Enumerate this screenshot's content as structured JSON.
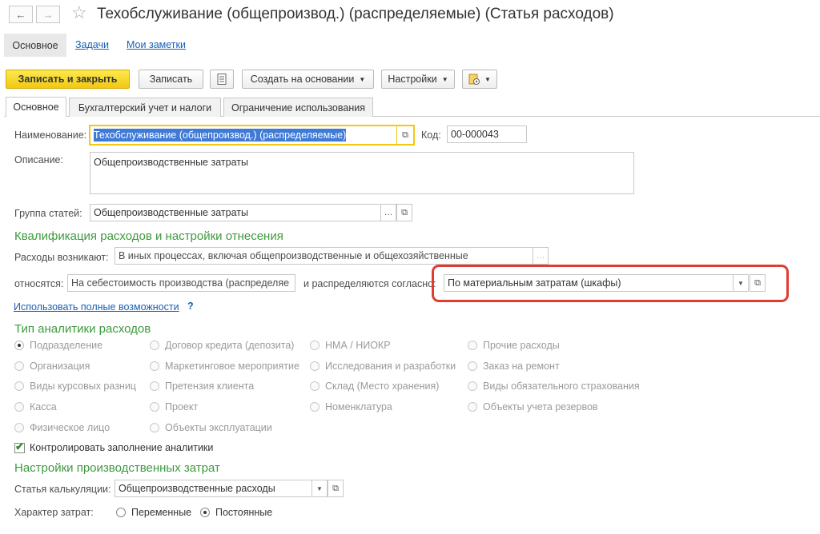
{
  "window": {
    "title": "Техобслуживание (общепроизвод.) (распределяемые) (Статья расходов)",
    "back_glyph": "←",
    "forward_glyph": "→",
    "star_glyph": "☆"
  },
  "header_tabs": [
    {
      "label": "Основное",
      "active": true
    },
    {
      "label": "Задачи",
      "active": false
    },
    {
      "label": "Мои заметки",
      "active": false
    }
  ],
  "toolbar": {
    "save_close": "Записать и закрыть",
    "save": "Записать",
    "create_based": "Создать на основании",
    "settings": "Настройки"
  },
  "form_tabs": [
    {
      "label": "Основное",
      "active": true
    },
    {
      "label": "Бухгалтерский учет и налоги",
      "active": false
    },
    {
      "label": "Ограничение использования",
      "active": false
    }
  ],
  "fields": {
    "name_label": "Наименование:",
    "name_value": "Техобслуживание (общепроизвод.) (распределяемые)",
    "code_label": "Код:",
    "code_value": "00-000043",
    "description_label": "Описание:",
    "description_value": "Общепроизводственные затраты",
    "group_label": "Группа статей:",
    "group_value": "Общепроизводственные затраты"
  },
  "qualification": {
    "title": "Квалификация расходов и настройки отнесения",
    "arise_label": "Расходы возникают:",
    "arise_value": "В иных процессах, включая общепроизводственные и общехозяйственные",
    "relate_label": "относятся:",
    "relate_value": "На себестоимость производства (распределяе",
    "distributed_label": "и распределяются согласно:",
    "distributed_value": "По материальным затратам (шкафы)",
    "full_link": "Использовать полные возможности",
    "help": "?"
  },
  "analytics": {
    "title": "Тип аналитики расходов",
    "columns": [
      [
        "Подразделение",
        "Организация",
        "Виды курсовых разниц",
        "Касса",
        "Физическое лицо"
      ],
      [
        "Договор кредита (депозита)",
        "Маркетинговое мероприятие",
        "Претензия клиента",
        "Проект",
        "Объекты эксплуатации"
      ],
      [
        "НМА / НИОКР",
        "Исследования и разработки",
        "Склад (Место хранения)",
        "Номенклатура"
      ],
      [
        "Прочие расходы",
        "Заказ на ремонт",
        "Виды обязательного страхования",
        "Объекты учета резервов"
      ]
    ],
    "selected": "Подразделение",
    "control_label": "Контролировать заполнение аналитики",
    "control_checked": true
  },
  "production": {
    "title": "Настройки производственных затрат",
    "calc_label": "Статья калькуляции:",
    "calc_value": "Общепроизводственные расходы",
    "nature_label": "Характер затрат:",
    "options": [
      "Переменные",
      "Постоянные"
    ],
    "selected": "Постоянные"
  },
  "colors": {
    "accent_yellow": "#f2c811",
    "section_green": "#3d9a3d",
    "highlight_red": "#e03c31",
    "link_blue": "#1a5fb4",
    "selection_blue": "#3e7ad6"
  }
}
